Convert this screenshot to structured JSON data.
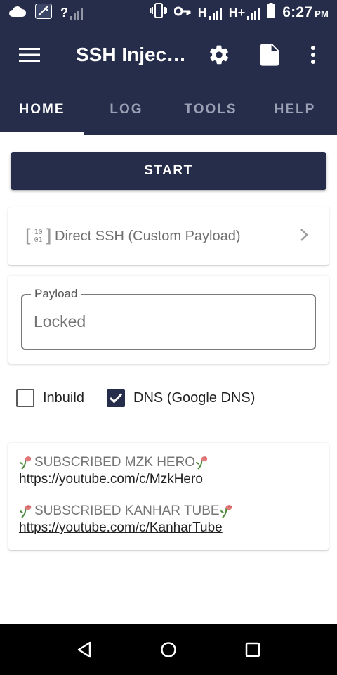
{
  "status_bar": {
    "time": "6:27",
    "ampm": "PM",
    "network_1": "H",
    "network_2": "H+",
    "sim_unknown": "?"
  },
  "app_bar": {
    "title": "SSH Injec…"
  },
  "tabs": [
    {
      "label": "HOME",
      "active": true
    },
    {
      "label": "LOG",
      "active": false
    },
    {
      "label": "TOOLS",
      "active": false
    },
    {
      "label": "HELP",
      "active": false
    }
  ],
  "start_button": {
    "label": "START"
  },
  "mode": {
    "label": "Direct SSH (Custom Payload)",
    "icon": "binary-icon"
  },
  "payload": {
    "label": "Payload",
    "placeholder": "Locked"
  },
  "options": {
    "inbuild": {
      "label": "Inbuild",
      "checked": false
    },
    "dns": {
      "label": "DNS (Google DNS)",
      "checked": true
    }
  },
  "info": {
    "line1": "SUBSCRIBED MZK HERO",
    "link1": "https://youtube.com/c/MzkHero",
    "line2": "SUBSCRIBED KANHAR TUBE",
    "link2": "https://youtube.com/c/KanharTube"
  },
  "colors": {
    "primary": "#252d4a",
    "tab_inactive": "#9aa0b4",
    "muted_text": "#757575"
  }
}
